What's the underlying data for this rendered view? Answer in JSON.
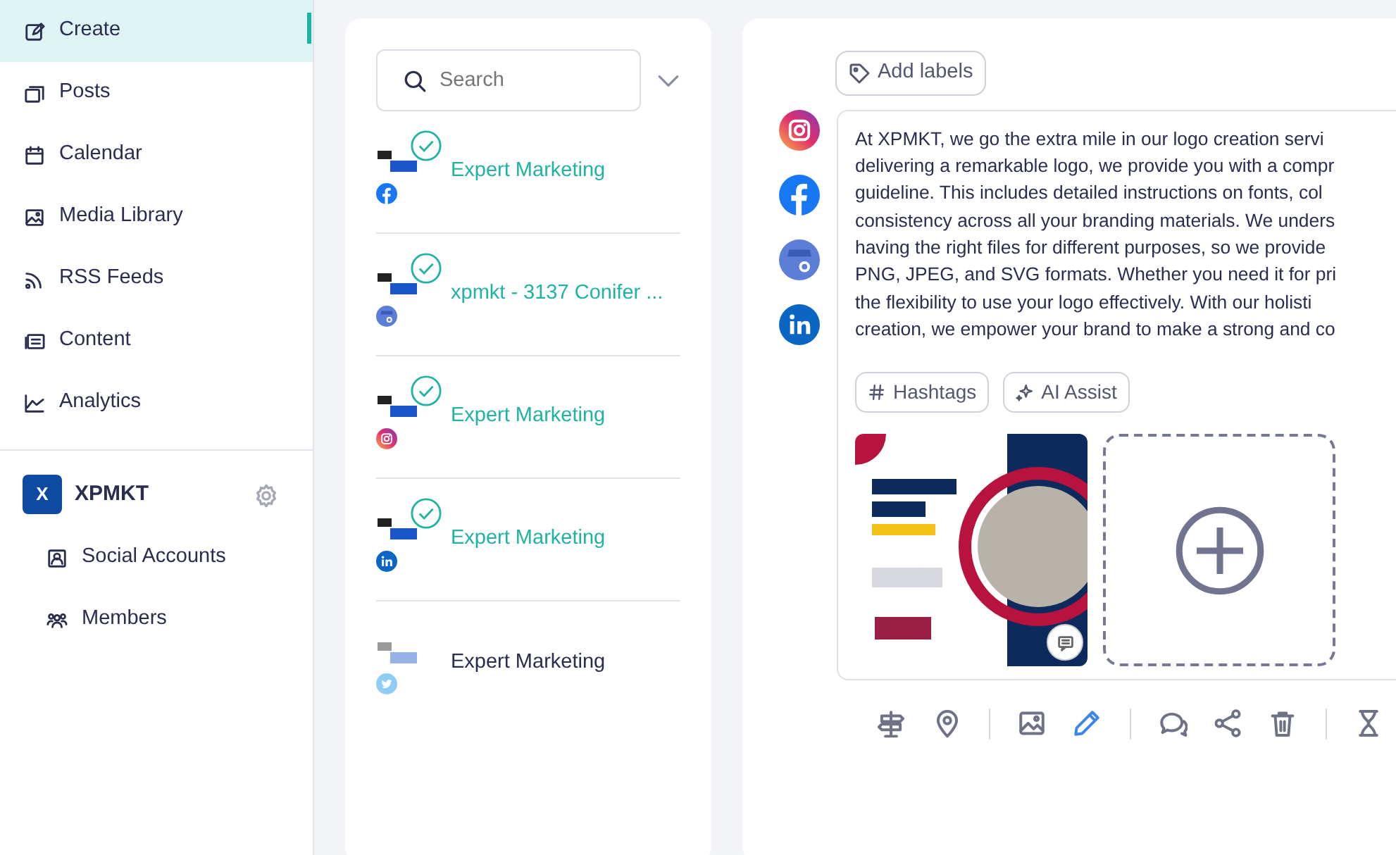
{
  "sidebar": {
    "items": [
      {
        "label": "Create",
        "kind": "edit",
        "selected": true
      },
      {
        "label": "Posts",
        "kind": "posts",
        "selected": false
      },
      {
        "label": "Calendar",
        "kind": "calendar",
        "selected": false
      },
      {
        "label": "Media Library",
        "kind": "image",
        "selected": false
      },
      {
        "label": "RSS Feeds",
        "kind": "rss",
        "selected": false
      },
      {
        "label": "Content",
        "kind": "content",
        "selected": false
      },
      {
        "label": "Analytics",
        "kind": "analytics",
        "selected": false
      }
    ],
    "workspace": {
      "initial": "X",
      "name": "XPMKT"
    },
    "workspace_items": [
      {
        "label": "Social Accounts",
        "kind": "account"
      },
      {
        "label": "Members",
        "kind": "members"
      }
    ]
  },
  "accounts": {
    "search": {
      "placeholder": "Search"
    },
    "items": [
      {
        "name": "Expert Marketing",
        "kind": "facebook",
        "selected": true
      },
      {
        "name": "xpmkt - 3137 Conifer ...",
        "kind": "google",
        "selected": true
      },
      {
        "name": "Expert Marketing",
        "kind": "instagram",
        "selected": true
      },
      {
        "name": "Expert Marketing",
        "kind": "linkedin",
        "selected": true
      },
      {
        "name": "Expert Marketing",
        "kind": "twitter",
        "selected": false
      }
    ]
  },
  "composer": {
    "add_labels": "Add labels",
    "networks": [
      {
        "kind": "instagram"
      },
      {
        "kind": "facebook"
      },
      {
        "kind": "google"
      },
      {
        "kind": "linkedin"
      }
    ],
    "text_lines": [
      "At XPMKT, we go the extra mile in our logo creation servi",
      "delivering a remarkable logo, we provide you with a compr",
      "guideline. This includes detailed instructions on fonts, col",
      "consistency across all your branding materials. We unders",
      "having the right files for different purposes, so we provide",
      "PNG, JPEG, and SVG formats. Whether you need it for pri",
      "the flexibility to use your logo effectively. With our holisti",
      "creation, we empower your brand to make a strong and co"
    ],
    "chips": [
      {
        "label": "Hashtags",
        "kind": "hash"
      },
      {
        "label": "AI Assist",
        "kind": "sparkle"
      }
    ],
    "toolbar": [
      {
        "kind": "signpost",
        "selected": false
      },
      {
        "kind": "pin",
        "selected": false
      },
      {
        "kind": "divider"
      },
      {
        "kind": "image",
        "selected": false
      },
      {
        "kind": "pencil",
        "selected": true
      },
      {
        "kind": "divider"
      },
      {
        "kind": "chat",
        "selected": false
      },
      {
        "kind": "share",
        "selected": false
      },
      {
        "kind": "trash",
        "selected": false
      },
      {
        "kind": "divider"
      },
      {
        "kind": "hourglass",
        "selected": false
      }
    ]
  }
}
